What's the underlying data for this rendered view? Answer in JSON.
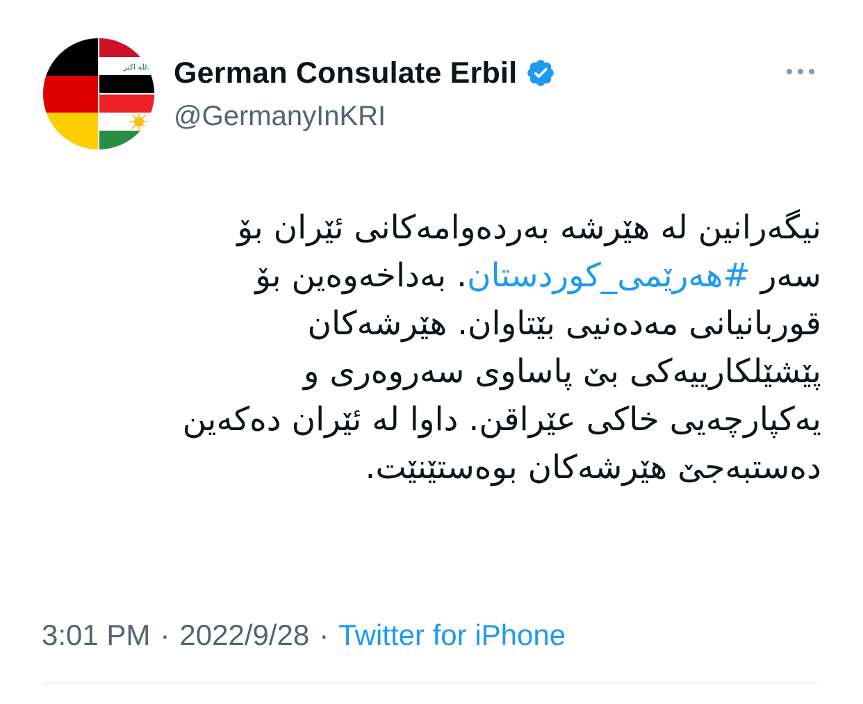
{
  "author": {
    "display_name": "German Consulate Erbil",
    "handle": "@GermanyInKRI",
    "verified": true,
    "avatar_icon": "flags-avatar-icon",
    "avatar_flag_text": "الله اكبر"
  },
  "tweet": {
    "line1": "نیگەرانین لە هێرشە بەردەوامەکانی ئێران بۆ",
    "line2_before": "سەر ",
    "hashtag": "#هەرێمی_کوردستان",
    "line2_after": ". بەداخەوەین بۆ",
    "line3": "قوربانیانی مەدەنیی بێتاوان. هێرشەکان",
    "line4": "پێشێلکارییەکی بێ پاساوی سەروەری و",
    "line5": "یەکپارچەیی خاکی عێراقن. داوا لە ئێران دەکەین",
    "line6": "دەستبەجێ هێرشەکان بوەستێنێت."
  },
  "meta": {
    "time": "3:01 PM",
    "separator": "·",
    "date": "2022/9/28",
    "source": "Twitter for iPhone"
  },
  "colors": {
    "link": "#1d9bf0",
    "secondary_text": "#536471",
    "primary_text": "#0f1419",
    "verified_badge": "#1d9bf0"
  },
  "icons": {
    "verified": "verified-badge-icon",
    "more": "more-options-icon"
  }
}
